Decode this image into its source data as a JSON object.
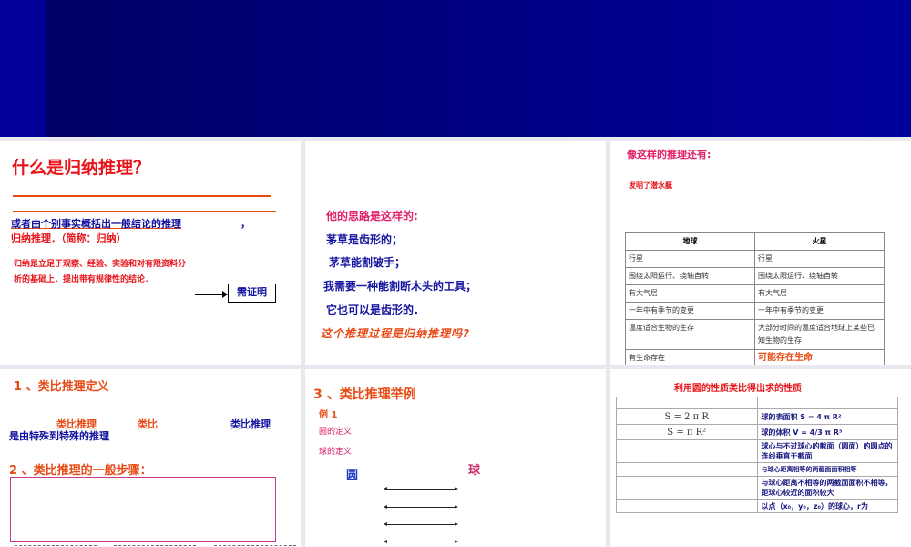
{
  "slide1": {
    "title": "什么是归纳推理？",
    "definition": "或者由个别事实概括出一般结论的推理",
    "comma": "，",
    "name_line": "归纳推理．（简称：归纳）",
    "note_line1": "归纳是立足于观察、经验、实验和对有限资料分",
    "note_line2": "析的基础上．提出带有规律性的结论．",
    "proof_box": "需证明"
  },
  "slide2": {
    "intro": "他的思路是这样的:",
    "lines": [
      "茅草是齿形的；",
      "茅草能割破手；",
      "我需要一种能割断木头的工具；",
      "它也可以是齿形的．"
    ],
    "question": "这个推理过程是归纳推理吗?"
  },
  "slide3": {
    "title": "像这样的推理还有:",
    "subtitle": "发明了潜水艇",
    "table": {
      "headers": [
        "地球",
        "火星"
      ],
      "rows": [
        [
          "行星",
          "行星"
        ],
        [
          "围绕太阳运行、绕轴自转",
          "围绕太阳运行、绕轴自转"
        ],
        [
          "有大气层",
          "有大气层"
        ],
        [
          "一年中有季节的变更",
          "一年中有季节的变更"
        ],
        [
          "温度适合生物的生存",
          "大部分时间的温度适合地球上某些已知生物的生存"
        ],
        [
          "有生命存在",
          "可能存在生命"
        ]
      ]
    }
  },
  "slide4": {
    "heading1": "1 、类比推理定义",
    "term1": "类比推理",
    "term2": "类比",
    "term3": "类比推理",
    "def_text": "是由特殊到特殊的推理",
    "heading2": "2 、类比推理的一般步骤："
  },
  "slide5": {
    "title": "3 、类比推理举例",
    "example": "例 1",
    "circle_def": "圆的定义",
    "sphere_def": "球的定义:",
    "circle": "圆",
    "sphere": "球"
  },
  "slide6": {
    "title": "利用圆的性质类比得出求的性质",
    "rows": [
      [
        "",
        ""
      ],
      [
        "S = 2 π R",
        "球的表面积 S = 4 π R²"
      ],
      [
        "S = π R²",
        "球的体积 V = 4/3 π R³"
      ],
      [
        "",
        "球心与不过球心的截面（圆面）的圆点的连线垂直于截面"
      ],
      [
        "",
        "与球心距离相等的两截面面积相等"
      ],
      [
        "",
        "与球心距离不相等的两截面面积不相等，距球心较近的面积较大"
      ],
      [
        "",
        "以点（x₀，y₀，z₀）的球心，r为"
      ]
    ]
  }
}
